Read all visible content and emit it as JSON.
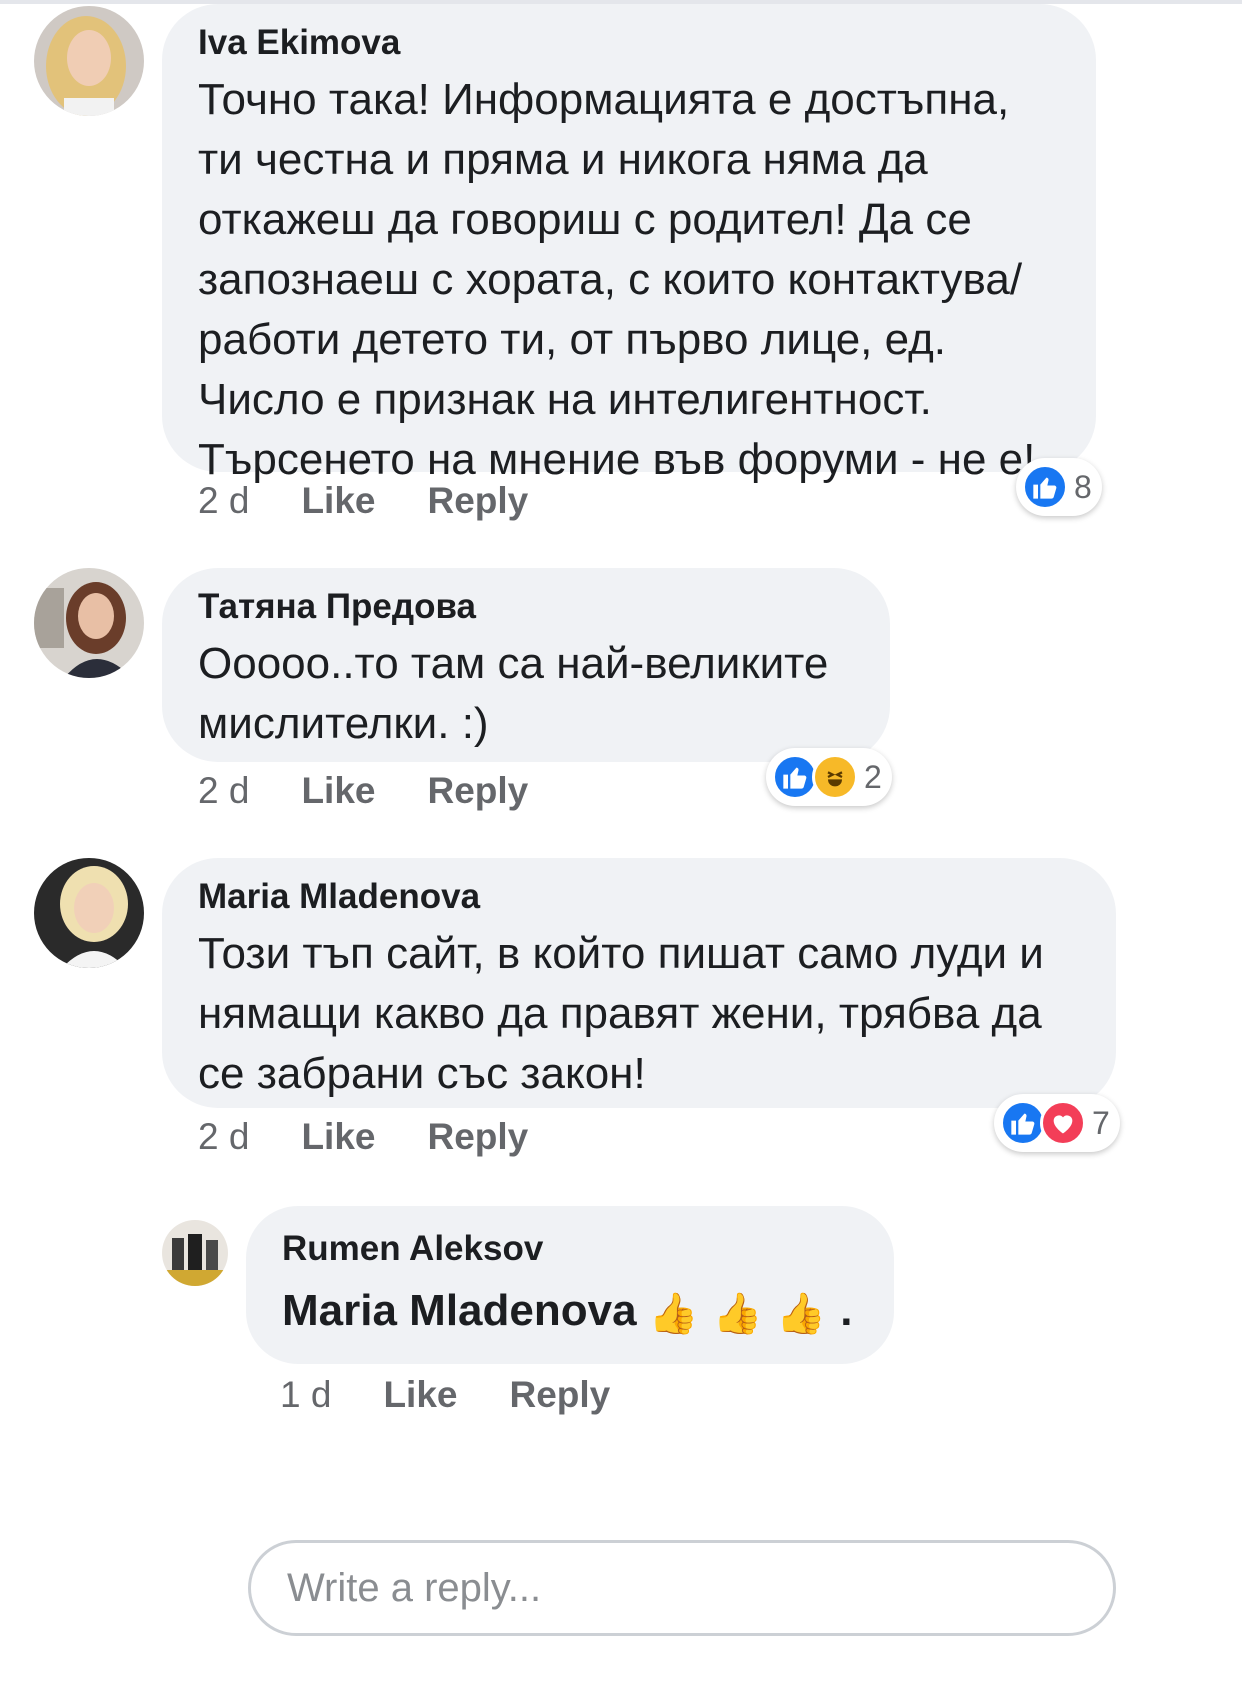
{
  "comments": [
    {
      "author": "Iva Ekimova",
      "text": "Точно така! Информацията е достъпна, ти честна и пряма и никога няма да откажеш да говориш с родител! Да се запознаеш с хората, с които контактува/ работи детето ти, от първо лице, ед. Число е признак на интелигентност. Търсенето на мнение във форуми - не е!",
      "time": "2 d",
      "like_label": "Like",
      "reply_label": "Reply",
      "reactions": {
        "types": [
          "like"
        ],
        "count": "8"
      }
    },
    {
      "author": "Татяна Предова",
      "text": "Ооооо..то там са най-великите мислителки. :)",
      "time": "2 d",
      "like_label": "Like",
      "reply_label": "Reply",
      "reactions": {
        "types": [
          "like",
          "haha"
        ],
        "count": "2"
      }
    },
    {
      "author": "Maria Mladenova",
      "text": "Този тъп сайт, в който пишат само луди и нямащи какво да правят жени, трябва да се забрани със закон!",
      "time": "2 d",
      "like_label": "Like",
      "reply_label": "Reply",
      "reactions": {
        "types": [
          "like",
          "love"
        ],
        "count": "7"
      }
    }
  ],
  "reply": {
    "author": "Rumen Aleksov",
    "mention": "Maria Mladenova",
    "emoji": "👍👍👍",
    "suffix": ".",
    "time": "1 d",
    "like_label": "Like",
    "reply_label": "Reply"
  },
  "write_reply": {
    "placeholder": "Write a reply..."
  },
  "colors": {
    "bubble": "#f0f2f5",
    "like": "#1877f2",
    "love": "#f33e58",
    "haha": "#f7b928",
    "meta": "#65676b"
  }
}
